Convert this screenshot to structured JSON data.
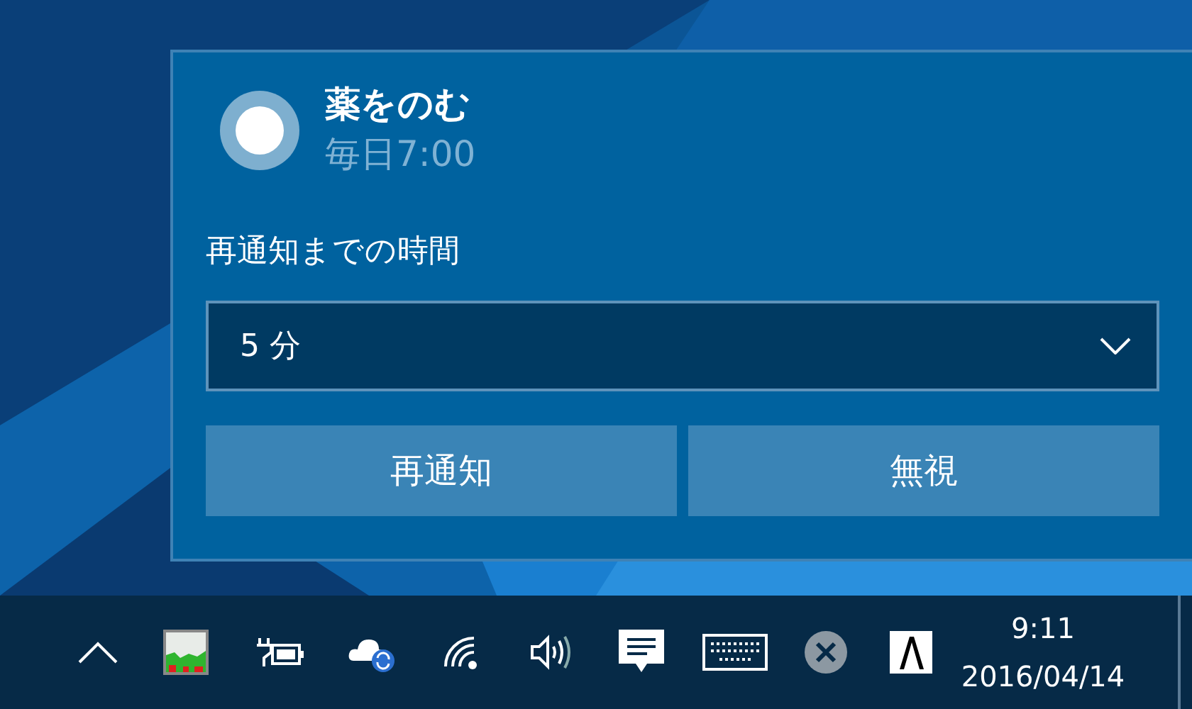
{
  "notification": {
    "title": "薬をのむ",
    "subtitle": "毎日7:00",
    "snooze_label": "再通知までの時間",
    "snooze_select": {
      "value": "5 分"
    },
    "buttons": [
      "再通知",
      "無視"
    ]
  },
  "taskbar": {
    "tray_icons": [
      {
        "kind": "chevron"
      },
      {
        "kind": "meter"
      },
      {
        "kind": "power"
      },
      {
        "kind": "cloud"
      },
      {
        "kind": "wifi"
      },
      {
        "kind": "volume"
      },
      {
        "kind": "message"
      },
      {
        "kind": "keyboard"
      },
      {
        "kind": "close"
      },
      {
        "kind": "app"
      }
    ],
    "clock": {
      "time": "9:11",
      "date": "2016/04/14"
    }
  }
}
